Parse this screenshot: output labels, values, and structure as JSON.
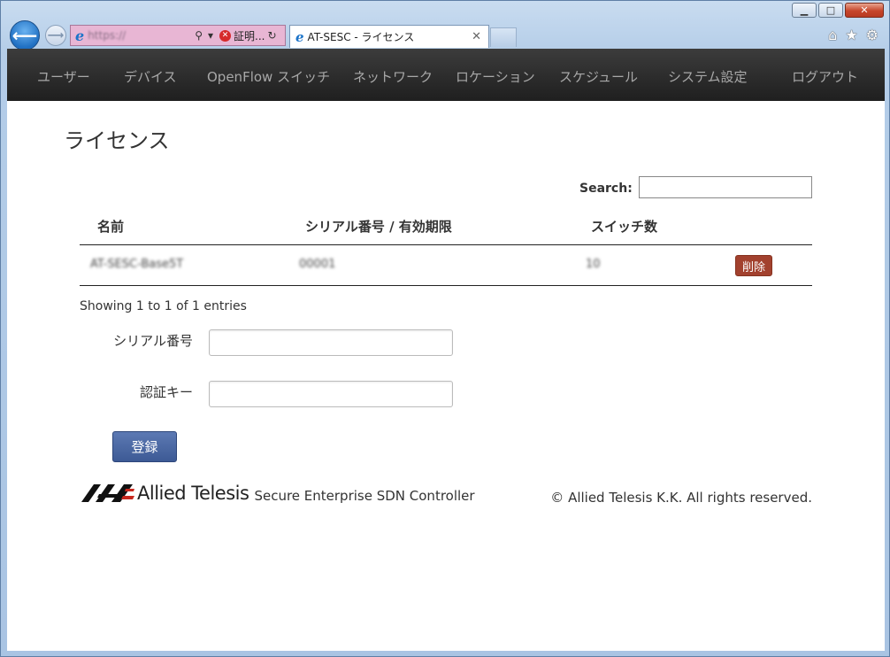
{
  "browser": {
    "address_text": "https://",
    "certificate_label": "証明...",
    "tab_title": "AT-SESC - ライセンス",
    "tab_close": "✕",
    "window_buttons": {
      "minimize": "▁",
      "maximize": "□",
      "close": "✕"
    },
    "toolbar_icons": [
      "home-icon",
      "star-icon",
      "gear-icon"
    ]
  },
  "nav": {
    "items": [
      {
        "label": "ユーザー"
      },
      {
        "label": "デバイス"
      },
      {
        "label": "OpenFlow スイッチ"
      },
      {
        "label": "ネットワーク"
      },
      {
        "label": "ロケーション"
      },
      {
        "label": "スケジュール"
      },
      {
        "label": "システム設定"
      },
      {
        "label": "ログアウト"
      }
    ]
  },
  "page": {
    "title": "ライセンス"
  },
  "search": {
    "label": "Search:",
    "value": ""
  },
  "table": {
    "headers": [
      "名前",
      "シリアル番号 / 有効期限",
      "スイッチ数"
    ],
    "rows": [
      {
        "name": "AT-SESC-Base5T",
        "serial": "00001",
        "switch_count": "10",
        "delete_label": "削除"
      }
    ]
  },
  "entries_info": "Showing 1 to 1 of 1 entries",
  "form": {
    "serial_label": "シリアル番号",
    "serial_value": "",
    "key_label": "認証キー",
    "key_value": "",
    "submit_label": "登録"
  },
  "footer": {
    "brand": "Allied Telesis",
    "product": "Secure Enterprise SDN Controller",
    "copyright": "© Allied Telesis K.K. All rights reserved."
  },
  "colors": {
    "navbar": "#262626",
    "delete_button": "#a2412e",
    "submit_button": "#4a67a3"
  }
}
